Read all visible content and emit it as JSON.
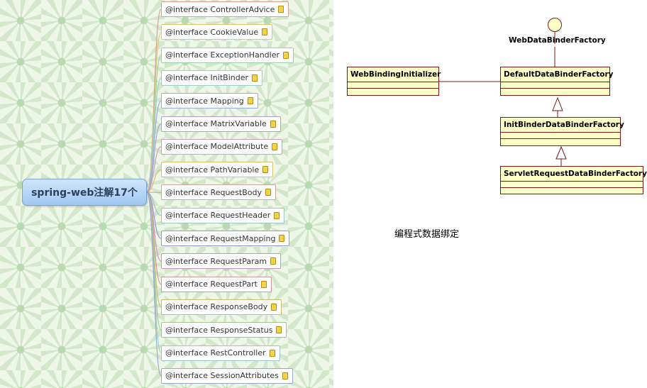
{
  "mindmap": {
    "root": "spring-web注解17个",
    "branches": [
      {
        "label": "@interface ControllerAdvice",
        "color": "#d4a090"
      },
      {
        "label": "@interface CookieValue",
        "color": "#d8c870"
      },
      {
        "label": "@interface ExceptionHandler",
        "color": "#9ad0a8"
      },
      {
        "label": "@interface InitBinder",
        "color": "#9ad0c8"
      },
      {
        "label": "@interface Mapping",
        "color": "#98b0d8"
      },
      {
        "label": "@interface MatrixVariable",
        "color": "#b0a0d8"
      },
      {
        "label": "@interface ModelAttribute",
        "color": "#d0a0b8"
      },
      {
        "label": "@interface PathVariable",
        "color": "#d8c070"
      },
      {
        "label": "@interface RequestBody",
        "color": "#d0a898"
      },
      {
        "label": "@interface RequestHeader",
        "color": "#9ac8c0"
      },
      {
        "label": "@interface RequestMapping",
        "color": "#9898d0"
      },
      {
        "label": "@interface RequestParam",
        "color": "#c898b8"
      },
      {
        "label": "@interface RequestPart",
        "color": "#d09898"
      },
      {
        "label": "@interface ResponseBody",
        "color": "#c8c070"
      },
      {
        "label": "@interface ResponseStatus",
        "color": "#a0c890"
      },
      {
        "label": "@interface RestController",
        "color": "#98c8c8"
      },
      {
        "label": "@interface SessionAttributes",
        "color": "#9aa8d0"
      }
    ]
  },
  "uml": {
    "interface_name": "WebDataBinderFactory",
    "classes": {
      "web_binding_initializer": "WebBindingInitializer",
      "default_factory": "DefaultDataBinderFactory",
      "init_binder_factory": "InitBinderDataBinderFactory",
      "servlet_factory": "ServletRequestDataBinderFactory"
    },
    "caption": "编程式数据绑定",
    "colors": {
      "class_fill": "#ffffc8",
      "class_border": "#7a1a1a"
    }
  }
}
